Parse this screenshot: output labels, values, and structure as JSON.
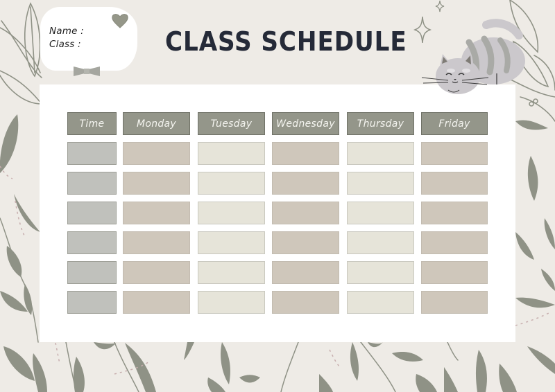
{
  "header": {
    "title": "CLASS SCHEDULE",
    "name_label": "Name :",
    "class_label": "Class :"
  },
  "table": {
    "columns": [
      "Time",
      "Monday",
      "Tuesday",
      "Wednesday",
      "Thursday",
      "Friday"
    ],
    "row_count": 6,
    "rows": [
      [
        "",
        "",
        "",
        "",
        "",
        ""
      ],
      [
        "",
        "",
        "",
        "",
        "",
        ""
      ],
      [
        "",
        "",
        "",
        "",
        "",
        ""
      ],
      [
        "",
        "",
        "",
        "",
        "",
        ""
      ],
      [
        "",
        "",
        "",
        "",
        "",
        ""
      ],
      [
        "",
        "",
        "",
        "",
        "",
        ""
      ]
    ]
  },
  "decorations": {
    "icons": [
      "heart-icon",
      "bow-icon",
      "sparkle-icon",
      "cat-illustration",
      "leaf-pattern"
    ]
  },
  "colors": {
    "background": "#eeebe6",
    "sheet": "#ffffff",
    "header_fill": "#94968a",
    "time_cell": "#c0c1bc",
    "tan_cell": "#cfc7bb",
    "cream_cell": "#e6e4d9",
    "title": "#252a38",
    "leaf": "#8f9286"
  }
}
